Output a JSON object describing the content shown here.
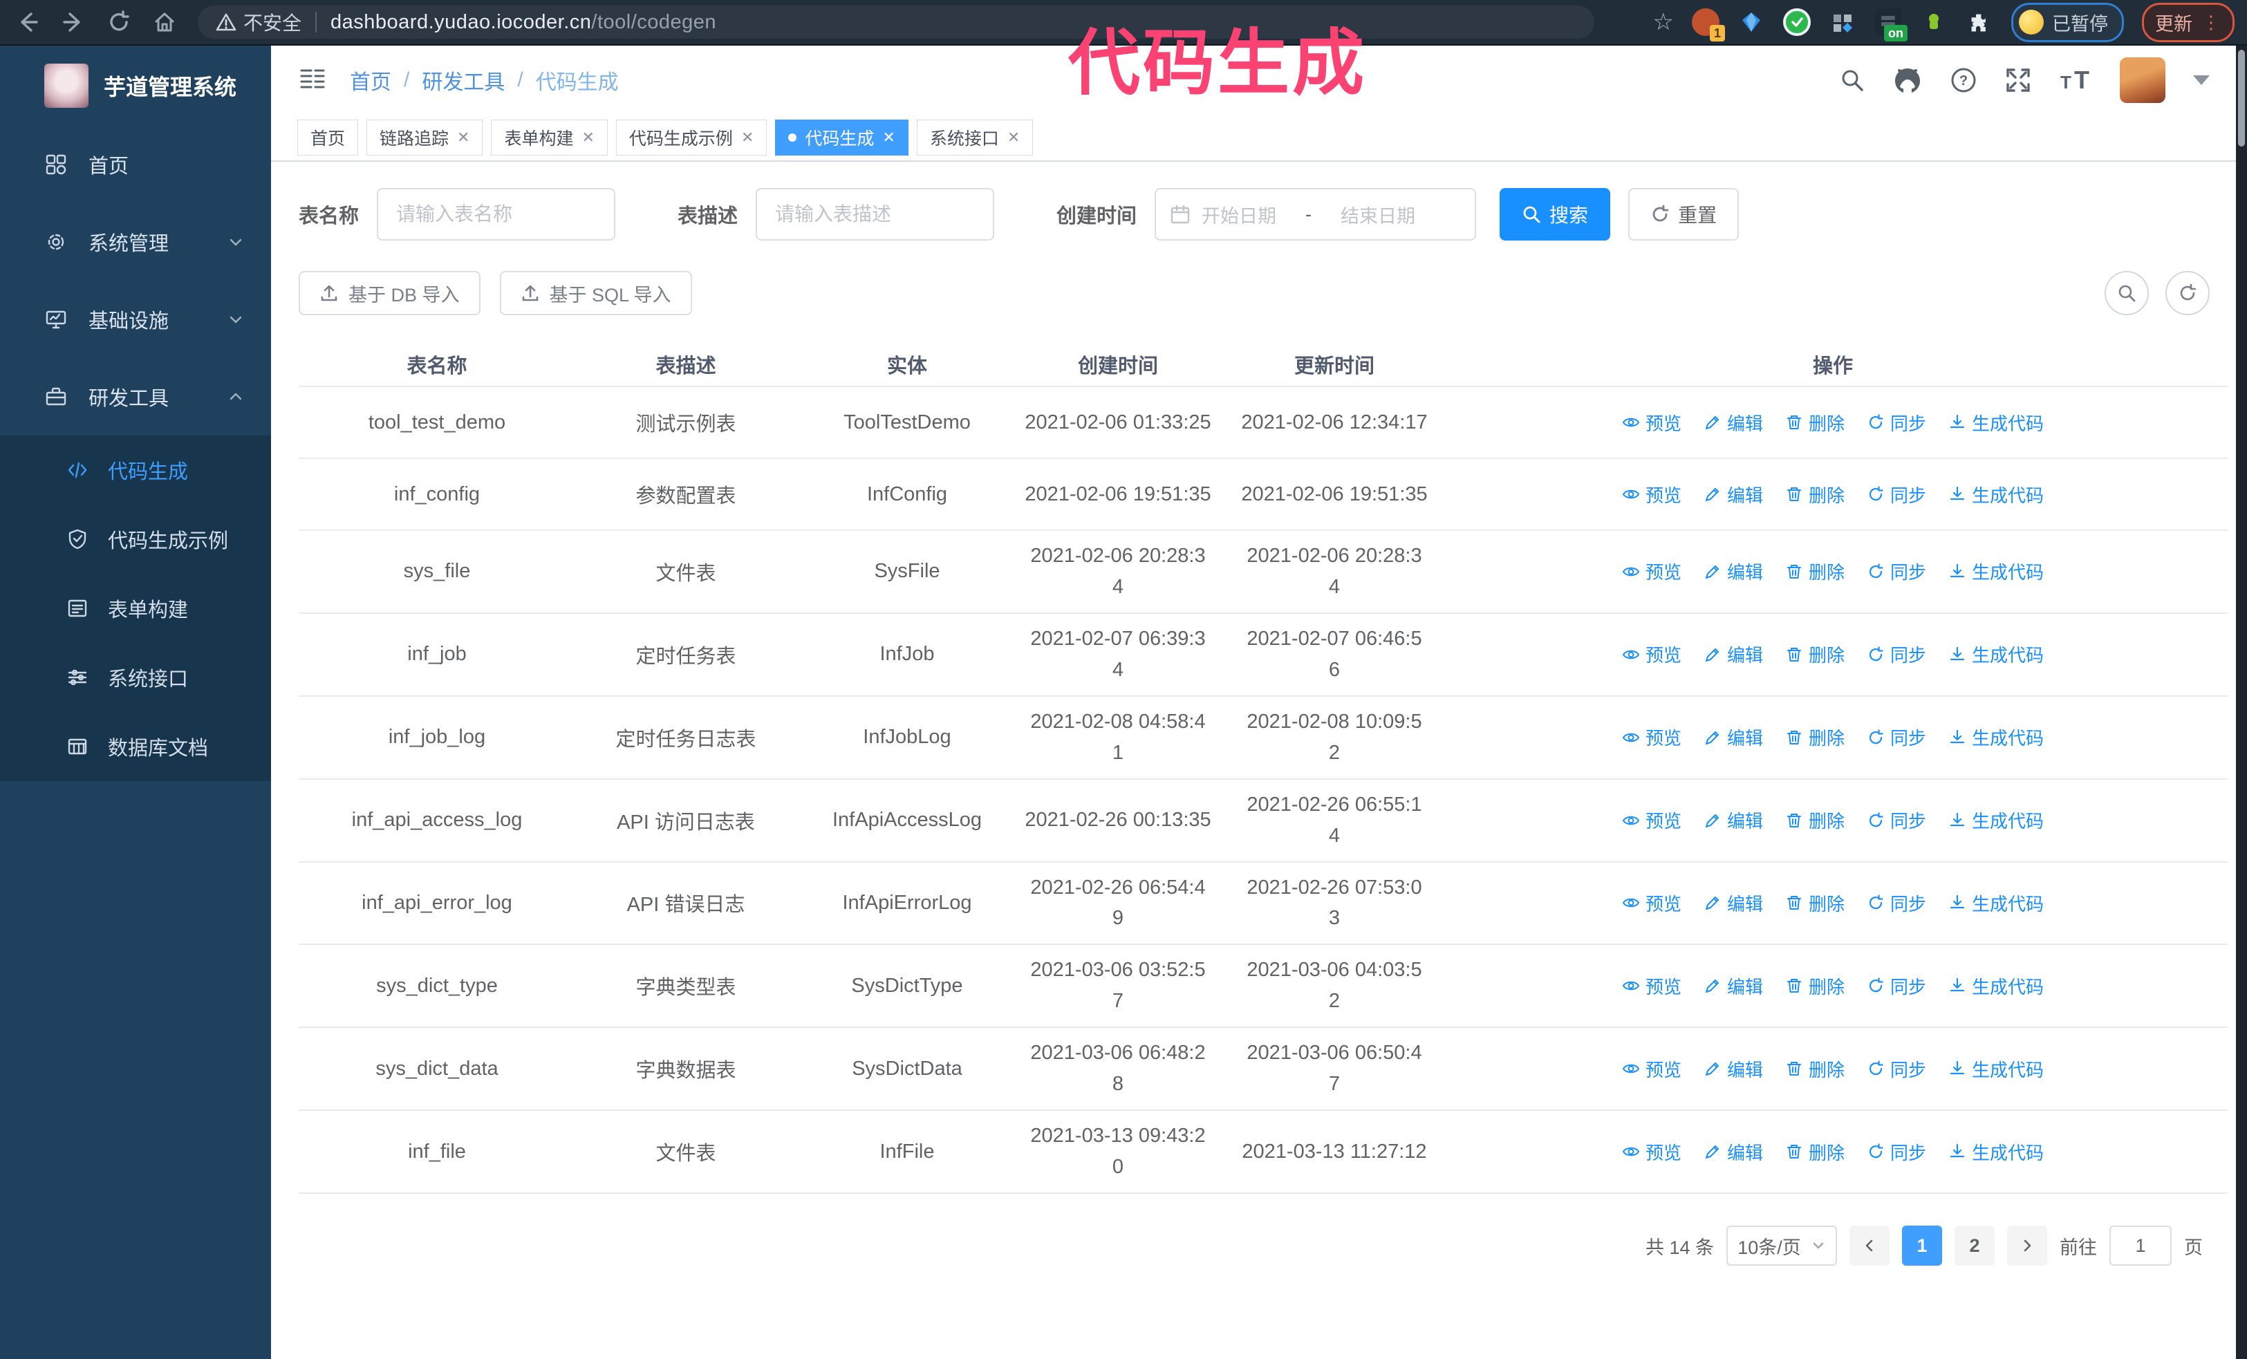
{
  "colors": {
    "accent": "#409eff",
    "link": "#1890ff",
    "annotation": "#fb4373",
    "sidebar_bg": "#1f415d",
    "submenu_bg": "#17354d"
  },
  "browser": {
    "security_label": "不安全",
    "url_host": "dashboard.yudao.iocoder.cn",
    "url_path": "/tool/codegen",
    "ext_badge_count": "1",
    "ext_on_label": "on",
    "paused_label": "已暂停",
    "update_label": "更新"
  },
  "overlay": {
    "annotation": "代码生成"
  },
  "sidebar": {
    "app_title": "芋道管理系统",
    "items": [
      {
        "label": "首页",
        "expandable": false
      },
      {
        "label": "系统管理",
        "expandable": true,
        "state": "collapsed"
      },
      {
        "label": "基础设施",
        "expandable": true,
        "state": "collapsed"
      },
      {
        "label": "研发工具",
        "expandable": true,
        "state": "expanded"
      }
    ],
    "subitems": [
      {
        "label": "代码生成",
        "active": true
      },
      {
        "label": "代码生成示例",
        "active": false
      },
      {
        "label": "表单构建",
        "active": false
      },
      {
        "label": "系统接口",
        "active": false
      },
      {
        "label": "数据库文档",
        "active": false
      }
    ]
  },
  "navbar": {
    "breadcrumb": [
      "首页",
      "研发工具",
      "代码生成"
    ],
    "separator": "/"
  },
  "tags": [
    {
      "label": "首页",
      "closable": false,
      "active": false
    },
    {
      "label": "链路追踪",
      "closable": true,
      "active": false
    },
    {
      "label": "表单构建",
      "closable": true,
      "active": false
    },
    {
      "label": "代码生成示例",
      "closable": true,
      "active": false
    },
    {
      "label": "代码生成",
      "closable": true,
      "active": true
    },
    {
      "label": "系统接口",
      "closable": true,
      "active": false
    }
  ],
  "search": {
    "name_label": "表名称",
    "name_placeholder": "请输入表名称",
    "desc_label": "表描述",
    "desc_placeholder": "请输入表描述",
    "time_label": "创建时间",
    "start_placeholder": "开始日期",
    "range_separator": "-",
    "end_placeholder": "结束日期",
    "search_label": "搜索",
    "reset_label": "重置"
  },
  "toolbar": {
    "db_import_label": "基于 DB 导入",
    "sql_import_label": "基于 SQL 导入"
  },
  "table": {
    "headers": [
      "表名称",
      "表描述",
      "实体",
      "创建时间",
      "更新时间",
      "操作"
    ],
    "actions": [
      "预览",
      "编辑",
      "删除",
      "同步",
      "生成代码"
    ],
    "rows": [
      {
        "name": "tool_test_demo",
        "desc": "测试示例表",
        "entity": "ToolTestDemo",
        "created": "2021-02-06 01:33:25",
        "updated": "2021-02-06 12:34:17"
      },
      {
        "name": "inf_config",
        "desc": "参数配置表",
        "entity": "InfConfig",
        "created": "2021-02-06 19:51:35",
        "updated": "2021-02-06 19:51:35"
      },
      {
        "name": "sys_file",
        "desc": "文件表",
        "entity": "SysFile",
        "created": "2021-02-06 20:28:3\n4",
        "updated": "2021-02-06 20:28:3\n4"
      },
      {
        "name": "inf_job",
        "desc": "定时任务表",
        "entity": "InfJob",
        "created": "2021-02-07 06:39:3\n4",
        "updated": "2021-02-07 06:46:5\n6"
      },
      {
        "name": "inf_job_log",
        "desc": "定时任务日志表",
        "entity": "InfJobLog",
        "created": "2021-02-08 04:58:4\n1",
        "updated": "2021-02-08 10:09:5\n2"
      },
      {
        "name": "inf_api_access_log",
        "desc": "API 访问日志表",
        "entity": "InfApiAccessLog",
        "created": "2021-02-26 00:13:35",
        "updated": "2021-02-26 06:55:1\n4"
      },
      {
        "name": "inf_api_error_log",
        "desc": "API 错误日志",
        "entity": "InfApiErrorLog",
        "created": "2021-02-26 06:54:4\n9",
        "updated": "2021-02-26 07:53:0\n3"
      },
      {
        "name": "sys_dict_type",
        "desc": "字典类型表",
        "entity": "SysDictType",
        "created": "2021-03-06 03:52:5\n7",
        "updated": "2021-03-06 04:03:5\n2"
      },
      {
        "name": "sys_dict_data",
        "desc": "字典数据表",
        "entity": "SysDictData",
        "created": "2021-03-06 06:48:2\n8",
        "updated": "2021-03-06 06:50:4\n7"
      },
      {
        "name": "inf_file",
        "desc": "文件表",
        "entity": "InfFile",
        "created": "2021-03-13 09:43:2\n0",
        "updated": "2021-03-13 11:27:12"
      }
    ]
  },
  "pagination": {
    "total_label": "共 14 条",
    "page_size_label": "10条/页",
    "pages": [
      "1",
      "2"
    ],
    "active_page": "1",
    "goto_label": "前往",
    "goto_value": "1",
    "page_unit_label": "页"
  }
}
